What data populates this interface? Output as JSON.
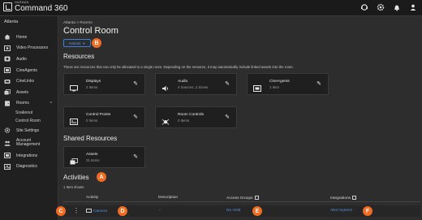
{
  "app": {
    "brand_small": "HARMAN",
    "brand_name": "Command 360"
  },
  "sidebar": {
    "site": "Atlanta",
    "items": [
      {
        "label": "Home",
        "icon": "home-icon"
      },
      {
        "label": "Video Processors",
        "icon": "video-processor-icon"
      },
      {
        "label": "Audio",
        "icon": "audio-icon"
      },
      {
        "label": "CineAgents",
        "icon": "cineagent-icon"
      },
      {
        "label": "CineLinks",
        "icon": "cinelink-icon"
      },
      {
        "label": "Assets",
        "icon": "assets-icon"
      },
      {
        "label": "Rooms",
        "icon": "rooms-icon"
      },
      {
        "label": "Site Settings",
        "icon": "gear-icon"
      },
      {
        "label": "Account Management",
        "icon": "account-icon"
      },
      {
        "label": "Integrations",
        "icon": "integrations-icon"
      },
      {
        "label": "Diagnostics",
        "icon": "diagnostics-icon"
      }
    ],
    "rooms_sub": [
      "Snakeout",
      "Control Room"
    ]
  },
  "main": {
    "breadcrumb": "Atlanta > Rooms",
    "title": "Control Room",
    "actions_label": "Actions",
    "resources_title": "Resources",
    "resources_desc": "These are resources that can only be allocated to a single room. Depending on the resource, it may automatically include linked assets into the room.",
    "cards": [
      {
        "title": "Displays",
        "sub": "2 Items",
        "icon": "display-icon"
      },
      {
        "title": "Audio",
        "sub": "4 Sources, 2 Zones",
        "icon": "speaker-icon"
      },
      {
        "title": "CineAgents",
        "sub": "1 Item",
        "icon": "cineagent-icon"
      },
      {
        "title": "Control Points",
        "sub": "0 Items",
        "icon": "control-point-icon"
      },
      {
        "title": "Room Controls",
        "sub": "0 Items",
        "icon": "room-controls-icon"
      }
    ],
    "shared_title": "Shared Resources",
    "shared_cards": [
      {
        "title": "Assets",
        "sub": "21 Items",
        "icon": "assets-icon"
      }
    ],
    "activities_title": "Activities",
    "items_shown": "1 Item shown",
    "table": {
      "headers": [
        "Activity",
        "Description",
        "Access Groups",
        "Integrations"
      ],
      "rows": [
        {
          "activity": "Camera",
          "description": "-",
          "access": "No Hold",
          "integration": "Alert System"
        }
      ]
    }
  },
  "callouts": [
    "A",
    "B",
    "C",
    "D",
    "E",
    "F"
  ],
  "colors": {
    "accent": "#f26b21",
    "link": "#4f95e6"
  }
}
